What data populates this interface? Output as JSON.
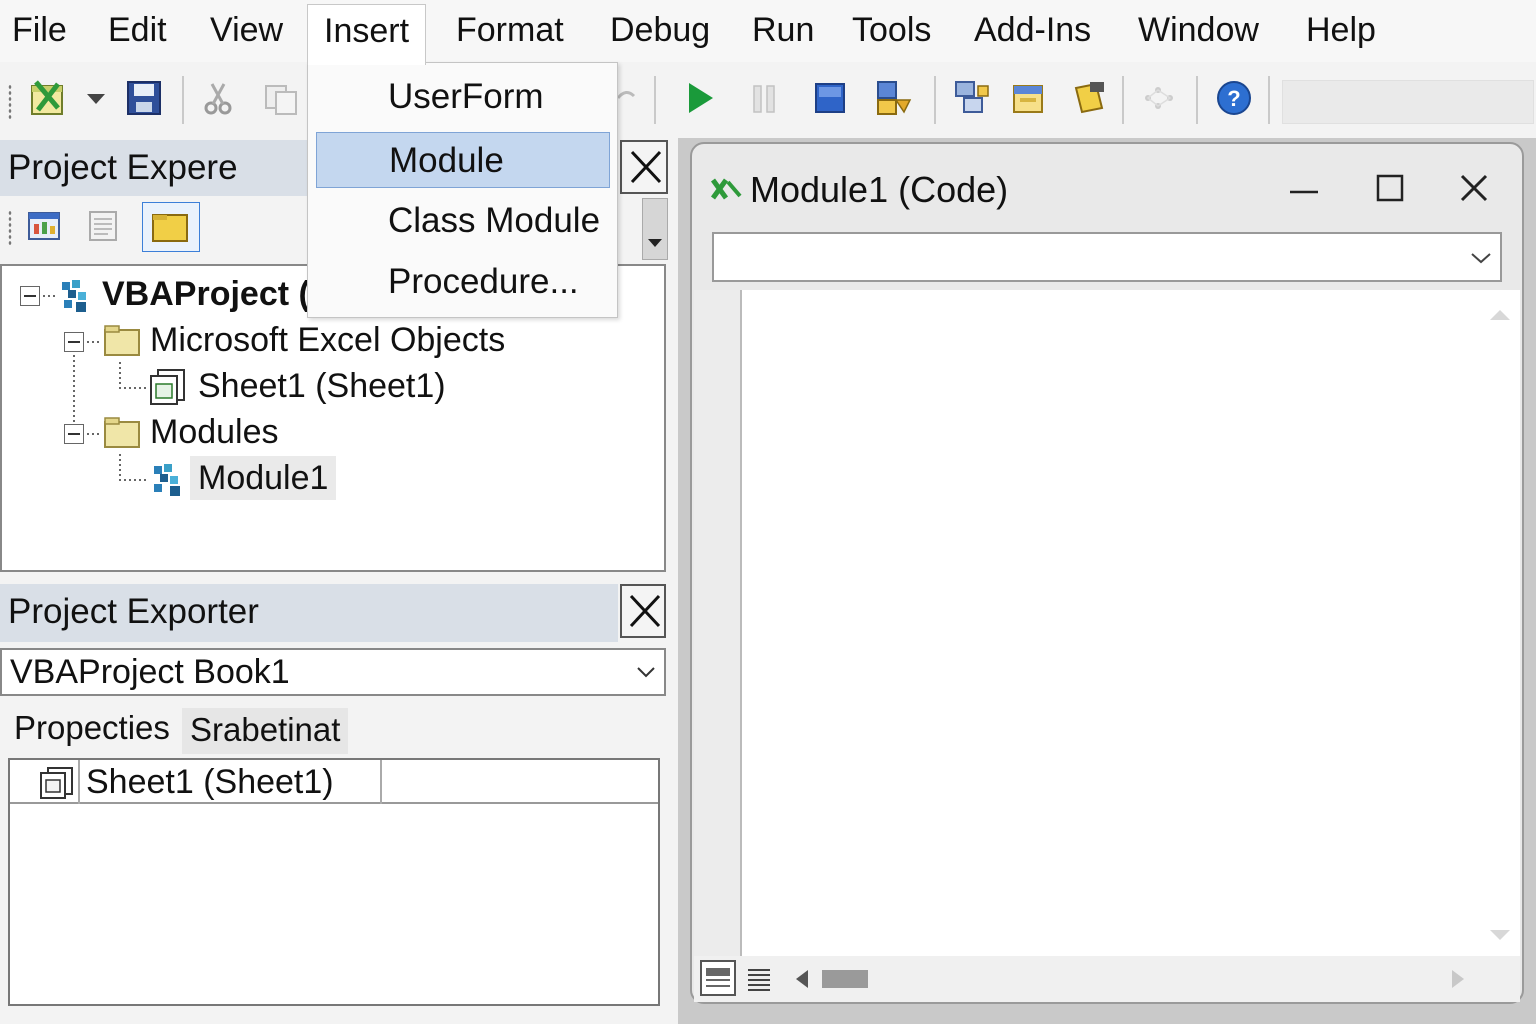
{
  "menubar": {
    "items": [
      "File",
      "Edit",
      "View",
      "Insert",
      "Format",
      "Debug",
      "Run",
      "Tools",
      "Add-Ins",
      "Window",
      "Help"
    ],
    "open_item": "Insert"
  },
  "insert_menu": {
    "items": [
      "UserForm",
      "Module",
      "Class Module",
      "Procedure..."
    ],
    "highlighted": "Module"
  },
  "toolbar": {
    "icons": [
      "excel-view-icon",
      "dropdown-arrow-icon",
      "save-icon",
      "cut-icon",
      "copy-icon",
      "undo-icon",
      "run-icon",
      "pause-icon",
      "stop-icon",
      "design-mode-icon",
      "project-explorer-icon",
      "properties-icon",
      "object-browser-icon",
      "toolbox-icon",
      "help-icon"
    ]
  },
  "project_explorer": {
    "title": "Project Expere",
    "toolbar_icons": [
      "view-object-icon",
      "view-code-icon",
      "toggle-folders-icon"
    ],
    "tree": {
      "root": "VBAProject (",
      "folders": [
        {
          "label": "Microsoft Excel Objects",
          "children": [
            "Sheet1 (Sheet1)"
          ]
        },
        {
          "label": "Modules",
          "children": [
            "Module1"
          ]
        }
      ],
      "selected": "Module1"
    }
  },
  "properties": {
    "title": "Project Exporter",
    "object_combo": "VBAProject Book1",
    "tabs": [
      "Propecties",
      "Srabetinat"
    ],
    "active_tab": "Propecties",
    "rows": [
      {
        "name": "Sheet1 (Sheet1)",
        "value": ""
      }
    ]
  },
  "code_window": {
    "title": "Module1 (Code)",
    "combo_value": "",
    "buttons": [
      "minimize-icon",
      "maximize-icon",
      "close-icon"
    ]
  },
  "colors": {
    "pane_title_bg": "#d9dfe7",
    "menu_highlight": "#c4d7ef",
    "run_green": "#1a9a3a",
    "help_blue": "#2d6fd1"
  }
}
